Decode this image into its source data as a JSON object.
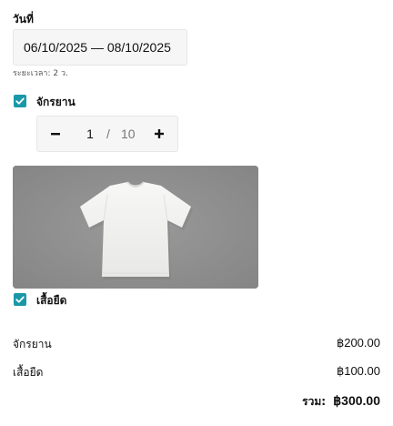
{
  "booking": {
    "date_label": "วันที่",
    "date_range": "06/10/2025 — 08/10/2025",
    "duration": "ระยะเวลา: 2 ว."
  },
  "items": [
    {
      "label": "จักรยาน",
      "checked": true,
      "quantity": "1",
      "separator": "/",
      "max": "10"
    },
    {
      "label": "เสื้อยืด",
      "checked": true,
      "image": "white-tshirt-on-gray-background"
    }
  ],
  "summary": {
    "rows": [
      {
        "name": "จักรยาน",
        "price": "฿200.00"
      },
      {
        "name": "เสื้อยืด",
        "price": "฿100.00"
      }
    ],
    "total_label": "รวม:",
    "total_value": "฿300.00"
  },
  "colors": {
    "accent": "#1a98a8",
    "image_background": "#909090",
    "field_background": "#f6f6f6"
  },
  "icons": {
    "checkbox": "check-icon",
    "decrement": "minus-icon",
    "increment": "plus-icon"
  }
}
